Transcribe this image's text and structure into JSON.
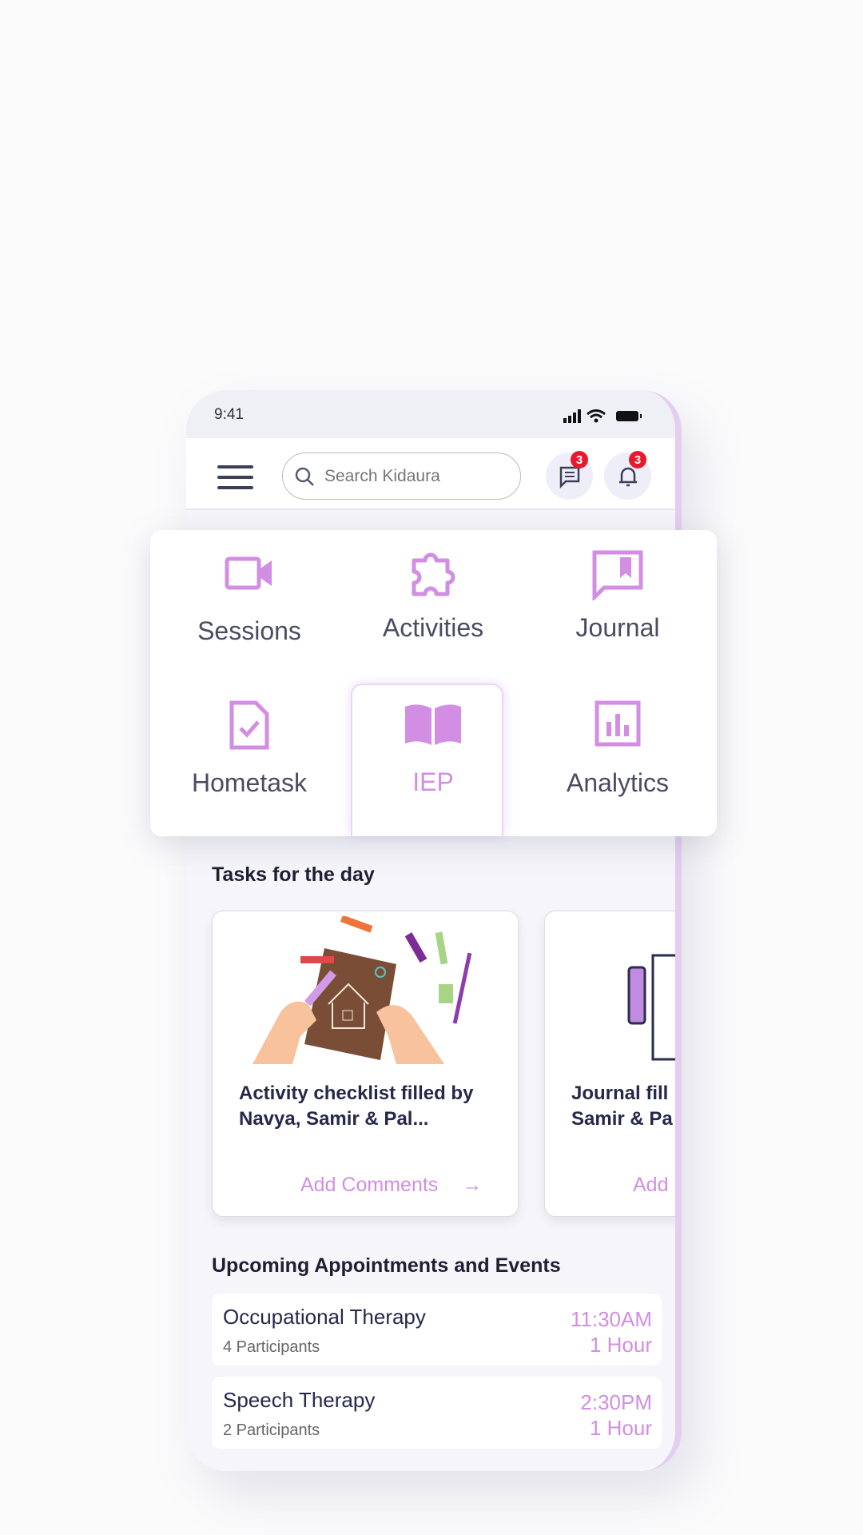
{
  "status": {
    "time": "9:41"
  },
  "header": {
    "search_placeholder": "Search Kidaura",
    "messages_badge": "3",
    "notifications_badge": "3"
  },
  "menu": {
    "items": [
      {
        "label": "Sessions",
        "icon": "video-camera-icon"
      },
      {
        "label": "Activities",
        "icon": "puzzle-icon"
      },
      {
        "label": "Journal",
        "icon": "bookmark-chat-icon"
      },
      {
        "label": "Hometask",
        "icon": "document-check-icon"
      },
      {
        "label": "IEP",
        "icon": "open-book-icon",
        "selected": true
      },
      {
        "label": "Analytics",
        "icon": "bar-chart-icon"
      }
    ]
  },
  "tasks": {
    "title": "Tasks for the day",
    "cards": [
      {
        "text": "Activity checklist filled by Navya, Samir & Pal...",
        "action": "Add Comments"
      },
      {
        "text": "Journal fill Samir & Pa",
        "action": "Add"
      }
    ]
  },
  "appointments": {
    "title": "Upcoming Appointments and Events",
    "items": [
      {
        "name": "Occupational Therapy",
        "participants": "4 Participants",
        "time": "11:30AM",
        "duration": "1 Hour"
      },
      {
        "name": "Speech Therapy",
        "participants": "2 Participants",
        "time": "2:30PM",
        "duration": "1 Hour"
      }
    ]
  },
  "colors": {
    "accent": "#d18ee3",
    "badge": "#e8192c",
    "text": "#25284a"
  }
}
